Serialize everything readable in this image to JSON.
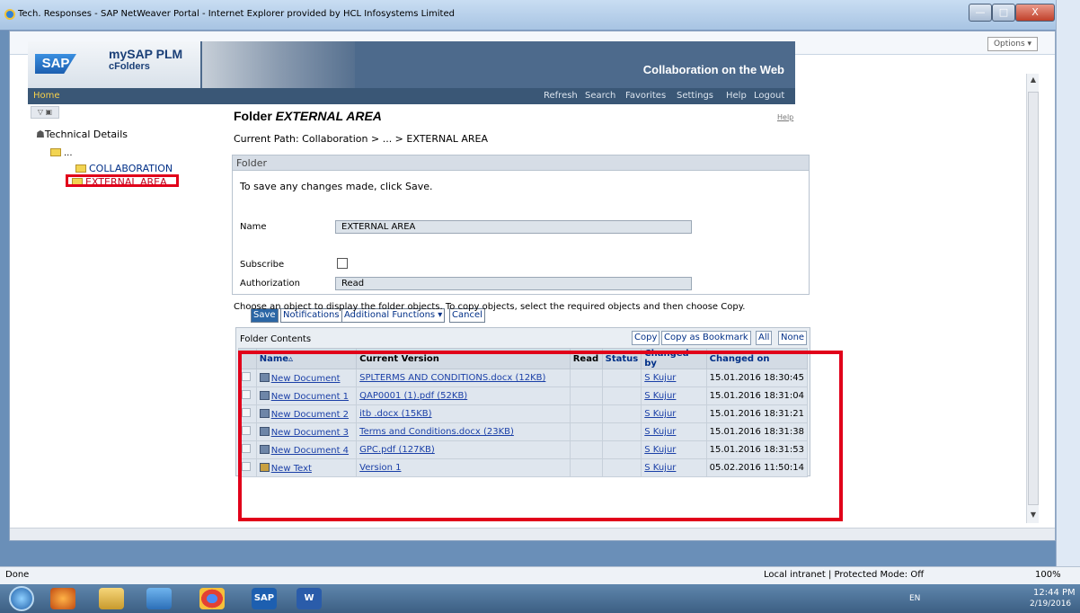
{
  "window": {
    "title": "Tech. Responses - SAP NetWeaver Portal - Internet Explorer provided by HCL Infosystems Limited",
    "minimize": "—",
    "maximize": "□",
    "close": "X"
  },
  "browser": {
    "options_label": "Options ▾"
  },
  "sap": {
    "product": "mySAP PLM",
    "sub": "cFolders",
    "logo": "SAP",
    "tagline": "Collaboration on the Web",
    "home": "Home",
    "nav": [
      "Refresh",
      "Search",
      "Favorites",
      "Settings",
      "Help",
      "Logout"
    ]
  },
  "tree": {
    "tools": "▽ ▣",
    "root": "Technical Details",
    "parent": "...",
    "child1": "COLLABORATION",
    "child2": "EXTERNAL AREA"
  },
  "main": {
    "title_prefix": "Folder",
    "title_name": "EXTERNAL AREA",
    "help": "Help",
    "path": "Current Path:  Collaboration > ... > EXTERNAL AREA",
    "panel_header": "Folder",
    "save_hint": "To save any changes made, click Save.",
    "fields": {
      "name_label": "Name",
      "name_value": "EXTERNAL AREA",
      "subscribe_label": "Subscribe",
      "authorization_label": "Authorization",
      "authorization_value": "Read"
    },
    "buttons": {
      "save": "Save",
      "notifications": "Notifications",
      "additional": "Additional Functions ▾",
      "cancel": "Cancel"
    },
    "hint": "Choose an object to display the folder objects. To copy objects, select the required objects and then choose Copy."
  },
  "contents": {
    "title": "Folder Contents",
    "buttons": {
      "copy": "Copy",
      "bookmark": "Copy as Bookmark",
      "all": "All",
      "none": "None"
    },
    "columns": [
      "Name▵",
      "Current Version",
      "Read",
      "Status",
      "Changed by",
      "Changed on"
    ],
    "rows": [
      {
        "name": "New Document",
        "version": "SPLTERMS AND CONDITIONS.docx (12KB)",
        "read": "",
        "status": "",
        "changed_by": "S Kujur",
        "changed_on": "15.01.2016 18:30:45"
      },
      {
        "name": "New Document 1",
        "version": "QAP0001 (1).pdf (52KB)",
        "read": "",
        "status": "",
        "changed_by": "S Kujur",
        "changed_on": "15.01.2016 18:31:04"
      },
      {
        "name": "New Document 2",
        "version": "itb .docx (15KB)",
        "read": "",
        "status": "",
        "changed_by": "S Kujur",
        "changed_on": "15.01.2016 18:31:21"
      },
      {
        "name": "New Document 3",
        "version": "Terms and Conditions.docx (23KB)",
        "read": "",
        "status": "",
        "changed_by": "S Kujur",
        "changed_on": "15.01.2016 18:31:38"
      },
      {
        "name": "New Document 4",
        "version": "GPC.pdf (127KB)",
        "read": "",
        "status": "",
        "changed_by": "S Kujur",
        "changed_on": "15.01.2016 18:31:53"
      },
      {
        "name": "New Text",
        "version": "Version 1",
        "read": "",
        "status": "",
        "changed_by": "S Kujur",
        "changed_on": "05.02.2016 11:50:14"
      }
    ]
  },
  "statusbar": {
    "done": "Done",
    "zone": "Local intranet | Protected Mode: Off",
    "zoom": "100%"
  },
  "taskbar": {
    "sap": "SAP",
    "word": "W",
    "lang": "EN",
    "time": "12:44 PM",
    "date": "2/19/2016"
  }
}
